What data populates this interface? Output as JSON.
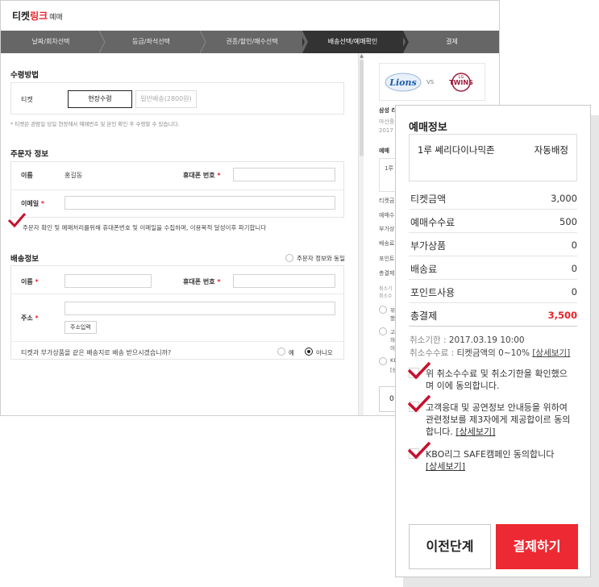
{
  "logo": {
    "main": "티켓",
    "accent": "링크",
    "sub": "예매"
  },
  "steps": [
    {
      "label": "날짜/회차선택",
      "active": false
    },
    {
      "label": "등급/좌석선택",
      "active": false
    },
    {
      "label": "권종/할인/매수선택",
      "active": false
    },
    {
      "label": "배송선택/예매확인",
      "active": true
    },
    {
      "label": "결제",
      "active": false
    }
  ],
  "receive": {
    "title": "수령방법",
    "ticket_label": "티켓",
    "option_onsite": "현장수령",
    "option_delivery": "일반배송(2800원)",
    "note": "* 티켓은 관람일 당일 현장에서 예매번호 및 본인 확인 후 수령할 수 있습니다."
  },
  "orderer": {
    "title": "주문자 정보",
    "name_label": "이름",
    "name_value": "홍길동",
    "phone_label": "휴대폰 번호",
    "email_label": "이메일",
    "consent": "주문자 확인 및 예매처리를위해 휴대폰번호 및 이메일을 수집하며, 이용목적 달성이후 파기합니다"
  },
  "delivery": {
    "title": "배송정보",
    "same_as_orderer": "주문자 정보와 동일",
    "name_label": "이름",
    "phone_label": "휴대폰 번호",
    "address_label": "주소",
    "address_button": "주소입력",
    "same_address_question": "티켓과 부가상품을 같은 배송지로 배송 받으시겠습니까?",
    "yes": "예",
    "no": "아니오",
    "selected": "no"
  },
  "match": {
    "home_team": "Lions",
    "vs": "VS",
    "away_team": "TWINS",
    "away_team_small": "LG",
    "partial_lines": [
      "삼성 리",
      "마산종",
      "2017"
    ],
    "partial_side": [
      "예매",
      "1루",
      "티켓금",
      "예매수",
      "부가상",
      "배송료",
      "포인트",
      "총결제",
      "취소기",
      "취소수",
      "위",
      "했",
      "고",
      "하",
      "이",
      "KE",
      "[상",
      "0"
    ]
  },
  "summary": {
    "title": "예매정보",
    "seat_name": "1루 쎄리다이나믹존",
    "seat_mode": "자동배정",
    "fees": [
      {
        "label": "티켓금액",
        "value": "3,000"
      },
      {
        "label": "예매수수료",
        "value": "500"
      },
      {
        "label": "부가상품",
        "value": "0"
      },
      {
        "label": "배송료",
        "value": "0"
      },
      {
        "label": "포인트사용",
        "value": "0"
      }
    ],
    "total_label": "총결제",
    "total_value": "3,500",
    "cancel_deadline_label": "취소기한 : ",
    "cancel_deadline_value": "2017.03.19 10:00",
    "cancel_fee_label": "취소수수료 : ",
    "cancel_fee_value": "티켓금액의 0~10%",
    "detail_link": "[상세보기]",
    "agreements": [
      {
        "text": "위 취소수수료 및 취소기한을 확인했으며 이에 동의합니다.",
        "link": ""
      },
      {
        "text": "고객응대 및 공연정보 안내등을 위하여 관련정보를 제3자에게 제공합이르 동의합니다.",
        "link": "[상세보기]"
      },
      {
        "text": "KBO리그 SAFE캠페인 동의합니다",
        "link": "[상세보기]"
      }
    ],
    "prev_button": "이전단계",
    "pay_button": "결제하기"
  },
  "colors": {
    "accent": "#ed2a33",
    "steps_bg": "#666666",
    "step_active": "#333333",
    "checkmark": "#c8102e"
  },
  "icons": [
    "checkmark-icon",
    "radio-icon",
    "lions-logo-icon",
    "twins-logo-icon"
  ]
}
